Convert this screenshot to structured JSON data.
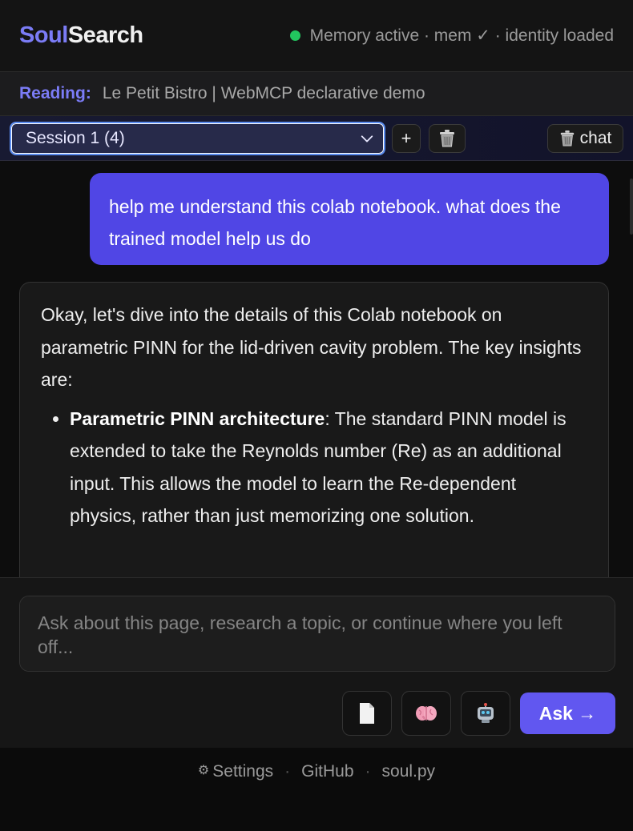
{
  "header": {
    "brand_part1": "Soul",
    "brand_part2": "Search",
    "status_text": "Memory active · mem ✓ · identity loaded",
    "status_color": "#22c55e"
  },
  "reading": {
    "label": "Reading:",
    "page_title": "Le Petit Bistro | WebMCP declarative demo"
  },
  "session": {
    "selected": "Session 1 (4)",
    "add_label": "+",
    "delete_icon": "trash-icon",
    "chat_label": "chat"
  },
  "messages": {
    "user_text": "help me understand this colab notebook. what does the trained model help us do",
    "assistant_intro": "Okay, let's dive into the details of this Colab notebook on parametric PINN for the lid-driven cavity problem. The key insights are:",
    "assistant_bullets": [
      {
        "bold": "Parametric PINN architecture",
        "text": ": The standard PINN model is extended to take the Reynolds number (Re) as an additional input. This allows the model to learn the Re-dependent physics, rather than just memorizing one solution."
      }
    ]
  },
  "composer": {
    "placeholder": "Ask about this page, research a topic, or continue where you left off...",
    "tools": [
      "document-icon",
      "brain-icon",
      "robot-icon"
    ],
    "ask_label": "Ask →",
    "accent": "#6157f0"
  },
  "footer": {
    "settings_label": "Settings",
    "github_label": "GitHub",
    "soul_label": "soul.py",
    "separator": "·"
  }
}
